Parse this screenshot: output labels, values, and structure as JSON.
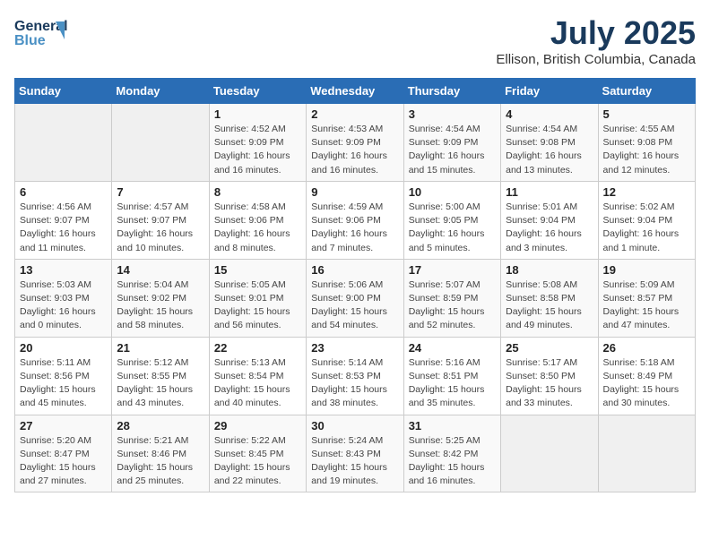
{
  "header": {
    "logo_line1": "General",
    "logo_line2": "Blue",
    "title": "July 2025",
    "location": "Ellison, British Columbia, Canada"
  },
  "weekdays": [
    "Sunday",
    "Monday",
    "Tuesday",
    "Wednesday",
    "Thursday",
    "Friday",
    "Saturday"
  ],
  "weeks": [
    [
      {
        "day": "",
        "detail": ""
      },
      {
        "day": "",
        "detail": ""
      },
      {
        "day": "1",
        "detail": "Sunrise: 4:52 AM\nSunset: 9:09 PM\nDaylight: 16 hours\nand 16 minutes."
      },
      {
        "day": "2",
        "detail": "Sunrise: 4:53 AM\nSunset: 9:09 PM\nDaylight: 16 hours\nand 16 minutes."
      },
      {
        "day": "3",
        "detail": "Sunrise: 4:54 AM\nSunset: 9:09 PM\nDaylight: 16 hours\nand 15 minutes."
      },
      {
        "day": "4",
        "detail": "Sunrise: 4:54 AM\nSunset: 9:08 PM\nDaylight: 16 hours\nand 13 minutes."
      },
      {
        "day": "5",
        "detail": "Sunrise: 4:55 AM\nSunset: 9:08 PM\nDaylight: 16 hours\nand 12 minutes."
      }
    ],
    [
      {
        "day": "6",
        "detail": "Sunrise: 4:56 AM\nSunset: 9:07 PM\nDaylight: 16 hours\nand 11 minutes."
      },
      {
        "day": "7",
        "detail": "Sunrise: 4:57 AM\nSunset: 9:07 PM\nDaylight: 16 hours\nand 10 minutes."
      },
      {
        "day": "8",
        "detail": "Sunrise: 4:58 AM\nSunset: 9:06 PM\nDaylight: 16 hours\nand 8 minutes."
      },
      {
        "day": "9",
        "detail": "Sunrise: 4:59 AM\nSunset: 9:06 PM\nDaylight: 16 hours\nand 7 minutes."
      },
      {
        "day": "10",
        "detail": "Sunrise: 5:00 AM\nSunset: 9:05 PM\nDaylight: 16 hours\nand 5 minutes."
      },
      {
        "day": "11",
        "detail": "Sunrise: 5:01 AM\nSunset: 9:04 PM\nDaylight: 16 hours\nand 3 minutes."
      },
      {
        "day": "12",
        "detail": "Sunrise: 5:02 AM\nSunset: 9:04 PM\nDaylight: 16 hours\nand 1 minute."
      }
    ],
    [
      {
        "day": "13",
        "detail": "Sunrise: 5:03 AM\nSunset: 9:03 PM\nDaylight: 16 hours\nand 0 minutes."
      },
      {
        "day": "14",
        "detail": "Sunrise: 5:04 AM\nSunset: 9:02 PM\nDaylight: 15 hours\nand 58 minutes."
      },
      {
        "day": "15",
        "detail": "Sunrise: 5:05 AM\nSunset: 9:01 PM\nDaylight: 15 hours\nand 56 minutes."
      },
      {
        "day": "16",
        "detail": "Sunrise: 5:06 AM\nSunset: 9:00 PM\nDaylight: 15 hours\nand 54 minutes."
      },
      {
        "day": "17",
        "detail": "Sunrise: 5:07 AM\nSunset: 8:59 PM\nDaylight: 15 hours\nand 52 minutes."
      },
      {
        "day": "18",
        "detail": "Sunrise: 5:08 AM\nSunset: 8:58 PM\nDaylight: 15 hours\nand 49 minutes."
      },
      {
        "day": "19",
        "detail": "Sunrise: 5:09 AM\nSunset: 8:57 PM\nDaylight: 15 hours\nand 47 minutes."
      }
    ],
    [
      {
        "day": "20",
        "detail": "Sunrise: 5:11 AM\nSunset: 8:56 PM\nDaylight: 15 hours\nand 45 minutes."
      },
      {
        "day": "21",
        "detail": "Sunrise: 5:12 AM\nSunset: 8:55 PM\nDaylight: 15 hours\nand 43 minutes."
      },
      {
        "day": "22",
        "detail": "Sunrise: 5:13 AM\nSunset: 8:54 PM\nDaylight: 15 hours\nand 40 minutes."
      },
      {
        "day": "23",
        "detail": "Sunrise: 5:14 AM\nSunset: 8:53 PM\nDaylight: 15 hours\nand 38 minutes."
      },
      {
        "day": "24",
        "detail": "Sunrise: 5:16 AM\nSunset: 8:51 PM\nDaylight: 15 hours\nand 35 minutes."
      },
      {
        "day": "25",
        "detail": "Sunrise: 5:17 AM\nSunset: 8:50 PM\nDaylight: 15 hours\nand 33 minutes."
      },
      {
        "day": "26",
        "detail": "Sunrise: 5:18 AM\nSunset: 8:49 PM\nDaylight: 15 hours\nand 30 minutes."
      }
    ],
    [
      {
        "day": "27",
        "detail": "Sunrise: 5:20 AM\nSunset: 8:47 PM\nDaylight: 15 hours\nand 27 minutes."
      },
      {
        "day": "28",
        "detail": "Sunrise: 5:21 AM\nSunset: 8:46 PM\nDaylight: 15 hours\nand 25 minutes."
      },
      {
        "day": "29",
        "detail": "Sunrise: 5:22 AM\nSunset: 8:45 PM\nDaylight: 15 hours\nand 22 minutes."
      },
      {
        "day": "30",
        "detail": "Sunrise: 5:24 AM\nSunset: 8:43 PM\nDaylight: 15 hours\nand 19 minutes."
      },
      {
        "day": "31",
        "detail": "Sunrise: 5:25 AM\nSunset: 8:42 PM\nDaylight: 15 hours\nand 16 minutes."
      },
      {
        "day": "",
        "detail": ""
      },
      {
        "day": "",
        "detail": ""
      }
    ]
  ]
}
